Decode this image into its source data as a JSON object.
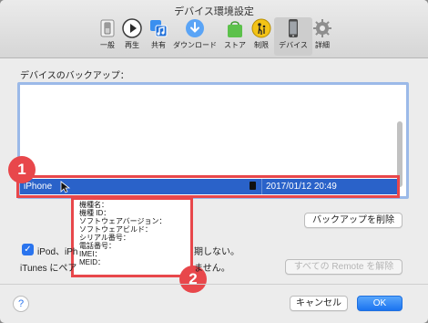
{
  "window": {
    "title": "デバイス環境設定"
  },
  "toolbar": {
    "items": [
      {
        "label": "一般",
        "icon": "switch-icon"
      },
      {
        "label": "再生",
        "icon": "play-icon"
      },
      {
        "label": "共有",
        "icon": "music-share-icon"
      },
      {
        "label": "ダウンロード",
        "icon": "download-icon"
      },
      {
        "label": "ストア",
        "icon": "shopping-bag-icon"
      },
      {
        "label": "制限",
        "icon": "parental-control-icon"
      },
      {
        "label": "デバイス",
        "icon": "iphone-icon"
      },
      {
        "label": "詳細",
        "icon": "gear-icon"
      }
    ],
    "active": "デバイス"
  },
  "backups": {
    "section_label": "デバイスのバックアップ：",
    "selected_row": {
      "name": "iPhone",
      "date": "2017/01/12 20:49"
    },
    "tooltip_lines": [
      "機種名：",
      "機種 ID：",
      "ソフトウェアバージョン：",
      "ソフトウェアビルド：",
      "シリアル番号：",
      "電話番号：",
      "IMEI：",
      "MEID："
    ],
    "delete_button": "バックアップを削除"
  },
  "options": {
    "sync_checkbox_prefix": "iPod、iPh",
    "sync_checkbox_suffix": "期しない。",
    "remote_text_prefix": "iTunes にペア",
    "remote_text_suffix": "ません。",
    "remote_button": "すべての Remote を解除"
  },
  "annotations": {
    "badge1": "1",
    "badge2": "2"
  },
  "footer": {
    "help": "?",
    "cancel": "キャンセル",
    "ok": "OK"
  },
  "colors": {
    "accent": "#2a74ee",
    "selection": "#2a62c9",
    "annotation": "#e8474b"
  }
}
